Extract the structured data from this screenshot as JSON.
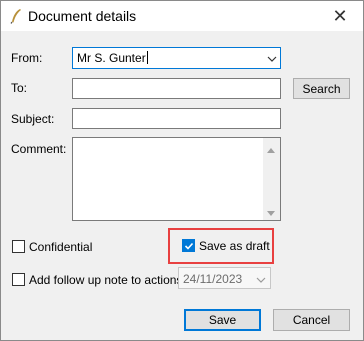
{
  "window": {
    "title": "Document details",
    "close_glyph": "✕"
  },
  "form": {
    "from_label": "From:",
    "from_value": "Mr S. Gunter",
    "to_label": "To:",
    "to_value": "",
    "subject_label": "Subject:",
    "subject_value": "",
    "comment_label": "Comment:",
    "comment_value": ""
  },
  "buttons": {
    "search": "Search",
    "save": "Save",
    "cancel": "Cancel"
  },
  "options": {
    "confidential_label": "Confidential",
    "confidential_checked": false,
    "save_as_draft_label": "Save as draft",
    "save_as_draft_checked": true,
    "follow_up_label": "Add follow up note to actions",
    "follow_up_checked": false,
    "follow_up_date": "24/11/2023"
  },
  "icons": {
    "title": "quill-pen-icon",
    "dropdown": "chevron-down-icon",
    "scroll_up": "scroll-up-arrow-icon",
    "scroll_down": "scroll-down-arrow-icon",
    "check": "checkmark-icon"
  },
  "colors": {
    "accent": "#0078d7",
    "highlight": "#e84040"
  }
}
